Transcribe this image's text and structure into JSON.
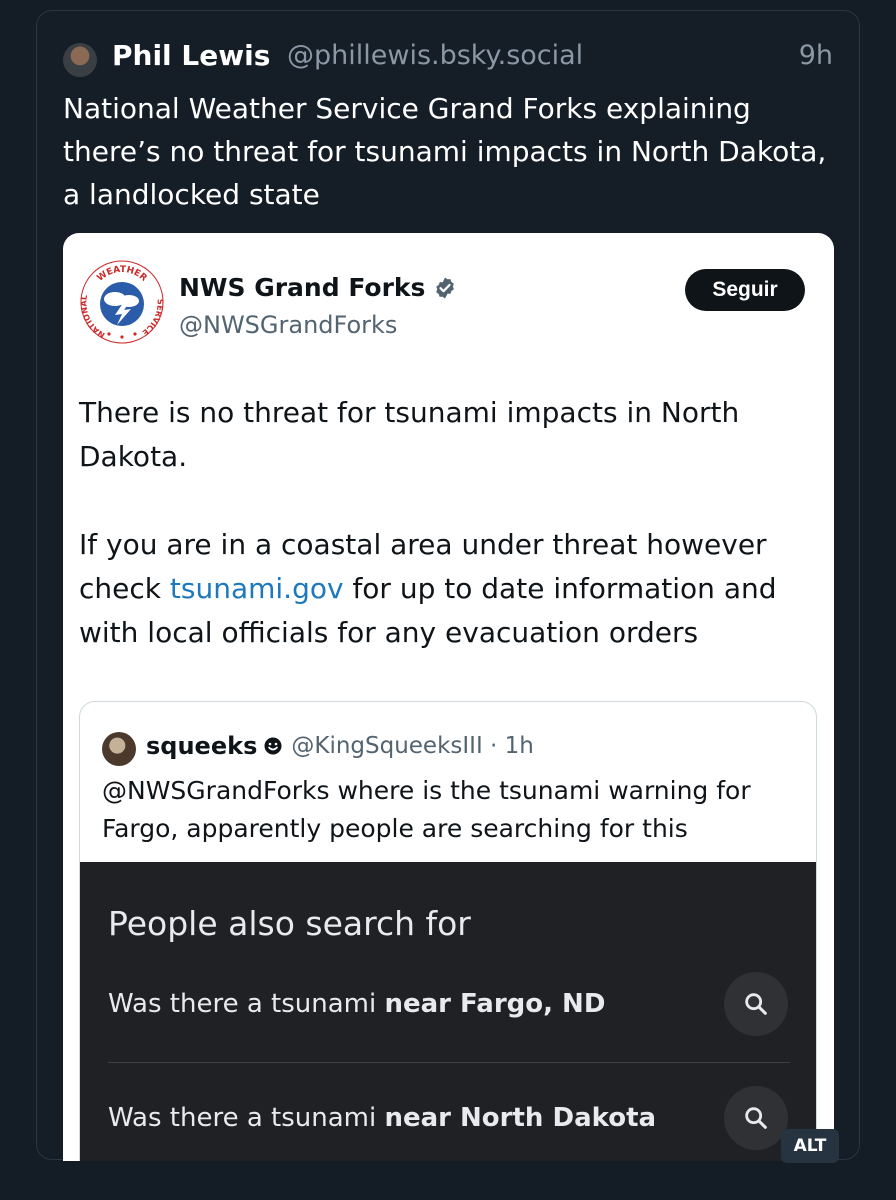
{
  "post": {
    "author_name": "Phil Lewis",
    "author_handle": "@phillewis.bsky.social",
    "time": "9h",
    "text": "National Weather Service Grand Forks explaining there’s no threat for tsunami impacts in North Dakota, a landlocked state",
    "alt_badge": "ALT"
  },
  "embed": {
    "account_name": "NWS Grand Forks",
    "account_handle": "@NWSGrandForks",
    "follow_label": "Seguir",
    "paragraph1": "There is no threat for tsunami impacts in North Dakota.",
    "paragraph2_before": "If you are in a coastal area under threat however check ",
    "paragraph2_link": "tsunami.gov",
    "paragraph2_after": " for up to date information and with local officials for any evacuation orders",
    "logo_text_top": "WEATHER",
    "logo_text_left": "NATIONAL",
    "logo_text_right": "SERVICE"
  },
  "quote": {
    "name": "squeeks",
    "handle_time": "@KingSqueeksIII · 1h",
    "text": "@NWSGrandForks where is the tsunami warning for Fargo, apparently people are searching for this",
    "search_panel": {
      "title": "People also search for",
      "rows": [
        {
          "prefix": "Was there a tsunami ",
          "bold": "near Fargo, ND"
        },
        {
          "prefix": "Was there a tsunami ",
          "bold": "near North Dakota"
        }
      ]
    }
  },
  "colors": {
    "background": "#141c25",
    "link": "#1d79bd",
    "verified": "#536471",
    "search_panel_bg": "#202124"
  }
}
